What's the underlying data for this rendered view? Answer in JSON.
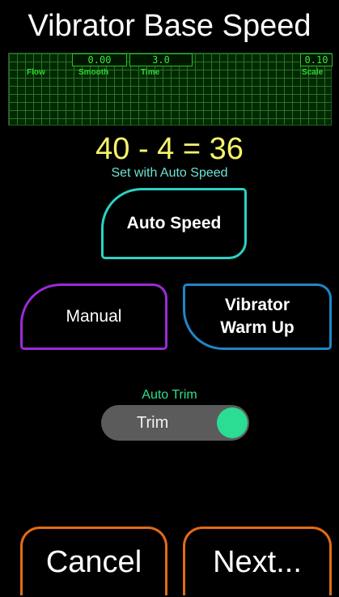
{
  "header": {
    "title": "Vibrator Base Speed"
  },
  "graph": {
    "smooth_value": "0.00",
    "time_value": "3.0",
    "scale_value": "0.10",
    "labels": {
      "flow": "Flow",
      "smooth": "Smooth",
      "time": "Time",
      "scale": "Scale"
    }
  },
  "equation": {
    "text": "40 - 4 = 36",
    "note": "Set with Auto Speed"
  },
  "buttons": {
    "auto_speed": "Auto Speed",
    "manual": "Manual",
    "vibrator_warm_up": "Vibrator Warm Up",
    "cancel": "Cancel",
    "next": "Next..."
  },
  "auto_trim": {
    "label": "Auto Trim",
    "toggle_text": "Trim",
    "enabled": true
  },
  "colors": {
    "title": "#ffffff",
    "equation": "#f6f36a",
    "subtext": "#6fe3d3",
    "auto_speed_border": "#2bd2c3",
    "manual_border": "#9b2bd6",
    "warm_up_border": "#1c87c8",
    "trim_label": "#2fdf8f",
    "toggle_knob": "#2bdc93",
    "nav_border": "#e36b16",
    "graph_grid": "#2f6f2f"
  }
}
